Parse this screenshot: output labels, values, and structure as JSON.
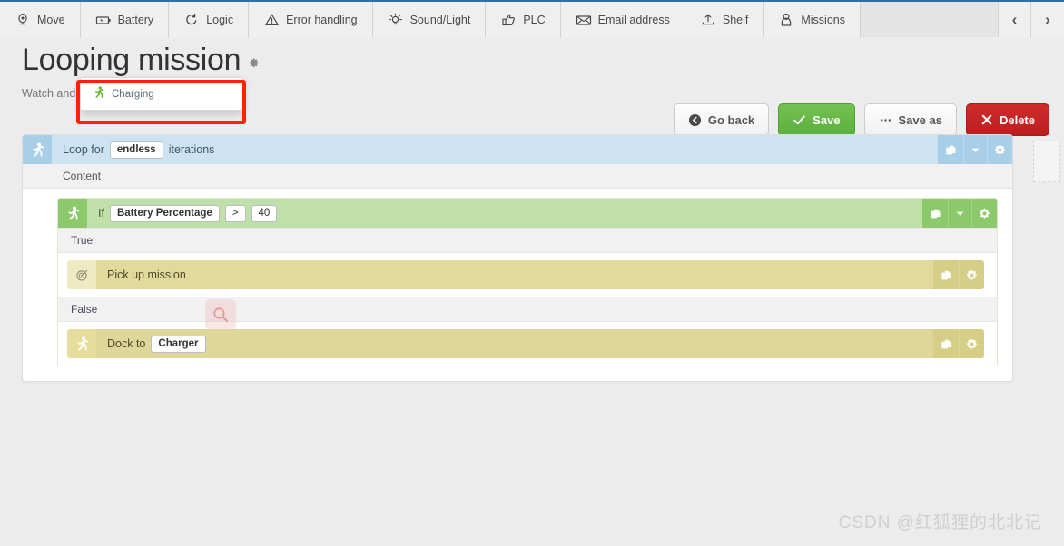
{
  "topbar": {
    "tabs": [
      {
        "label": "Move",
        "icon": "map-pin-icon"
      },
      {
        "label": "Battery",
        "icon": "battery-icon"
      },
      {
        "label": "Logic",
        "icon": "loop-arrow-icon"
      },
      {
        "label": "Error handling",
        "icon": "warning-triangle-icon"
      },
      {
        "label": "Sound/Light",
        "icon": "lightbulb-icon"
      },
      {
        "label": "PLC",
        "icon": "thumbs-up-icon"
      },
      {
        "label": "Email address",
        "icon": "envelope-icon"
      },
      {
        "label": "Shelf",
        "icon": "upload-shelf-icon"
      },
      {
        "label": "Missions",
        "icon": "person-icon"
      }
    ],
    "prev_label": "‹",
    "next_label": "›"
  },
  "header": {
    "title": "Looping mission",
    "subtitle": "Watch and edit the mission.",
    "help_glyph": "?",
    "gear_glyph": "⚙"
  },
  "dropdown": {
    "items": [
      {
        "label": "Charging",
        "icon": "running-person-icon"
      }
    ]
  },
  "actions": {
    "go_back": "Go back",
    "save": "Save",
    "save_as": "Save as",
    "delete": "Delete"
  },
  "editor": {
    "loop": {
      "icon": "running-person-icon",
      "prefix": "Loop for",
      "iterations": "endless",
      "suffix": "iterations",
      "content_label": "Content",
      "tools": [
        {
          "name": "duplicate-icon"
        },
        {
          "name": "chevron-down-icon"
        },
        {
          "name": "gear-icon"
        }
      ]
    },
    "condition": {
      "icon": "running-person-icon",
      "prefix": "If",
      "variable": "Battery Percentage",
      "operator": ">",
      "value": "40",
      "true_label": "True",
      "false_label": "False",
      "tools": [
        {
          "name": "duplicate-icon"
        },
        {
          "name": "chevron-down-icon"
        },
        {
          "name": "gear-icon"
        }
      ]
    },
    "true_action": {
      "icon": "target-icon",
      "label": "Pick up mission",
      "tools": [
        {
          "name": "duplicate-icon"
        },
        {
          "name": "gear-icon"
        }
      ]
    },
    "false_action": {
      "icon": "running-person-icon",
      "prefix": "Dock to",
      "target": "Charger",
      "tools": [
        {
          "name": "duplicate-icon"
        },
        {
          "name": "gear-icon"
        }
      ]
    }
  },
  "watermark": {
    "text": "CSDN @红狐狸的北北记"
  },
  "colors": {
    "accent_blue": "#2e6da4",
    "loop_blue": "#cde3f2",
    "condition_green": "#bfe0a8",
    "action_yellow": "#dfd79a",
    "save_green": "#5cb03c",
    "delete_red": "#bb1f1f",
    "annotation_red": "#ff2200"
  }
}
